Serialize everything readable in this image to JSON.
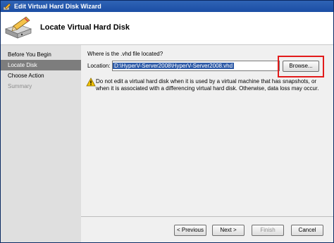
{
  "window": {
    "title": "Edit Virtual Hard Disk Wizard"
  },
  "header": {
    "title": "Locate Virtual Hard Disk"
  },
  "nav": {
    "items": [
      {
        "label": "Before You Begin",
        "state": "normal"
      },
      {
        "label": "Locate Disk",
        "state": "active"
      },
      {
        "label": "Choose Action",
        "state": "normal"
      },
      {
        "label": "Summary",
        "state": "disabled"
      }
    ]
  },
  "content": {
    "question": "Where is the .vhd file located?",
    "location_label": "Location:",
    "location_value": "D:\\HyperV-Server2008\\HyperV-Server2008.vhd",
    "browse_label": "Browse...",
    "warning_text": "Do not edit a virtual hard disk when it is used by a virtual machine that has snapshots, or when it is associated with a differencing virtual hard disk. Otherwise, data loss may occur."
  },
  "footer": {
    "previous_label": "< Previous",
    "next_label": "Next >",
    "finish_label": "Finish",
    "cancel_label": "Cancel"
  },
  "colors": {
    "titlebar": "#1b4ea5",
    "nav_active": "#7d7d7d",
    "selection": "#2d5aa7",
    "highlight_box": "#e21b1b",
    "warning": "#f2c200"
  },
  "icons": {
    "title_icon": "pencil-icon",
    "header_icon": "hard-disk-pencil-icon",
    "warning_icon": "warning-icon"
  }
}
